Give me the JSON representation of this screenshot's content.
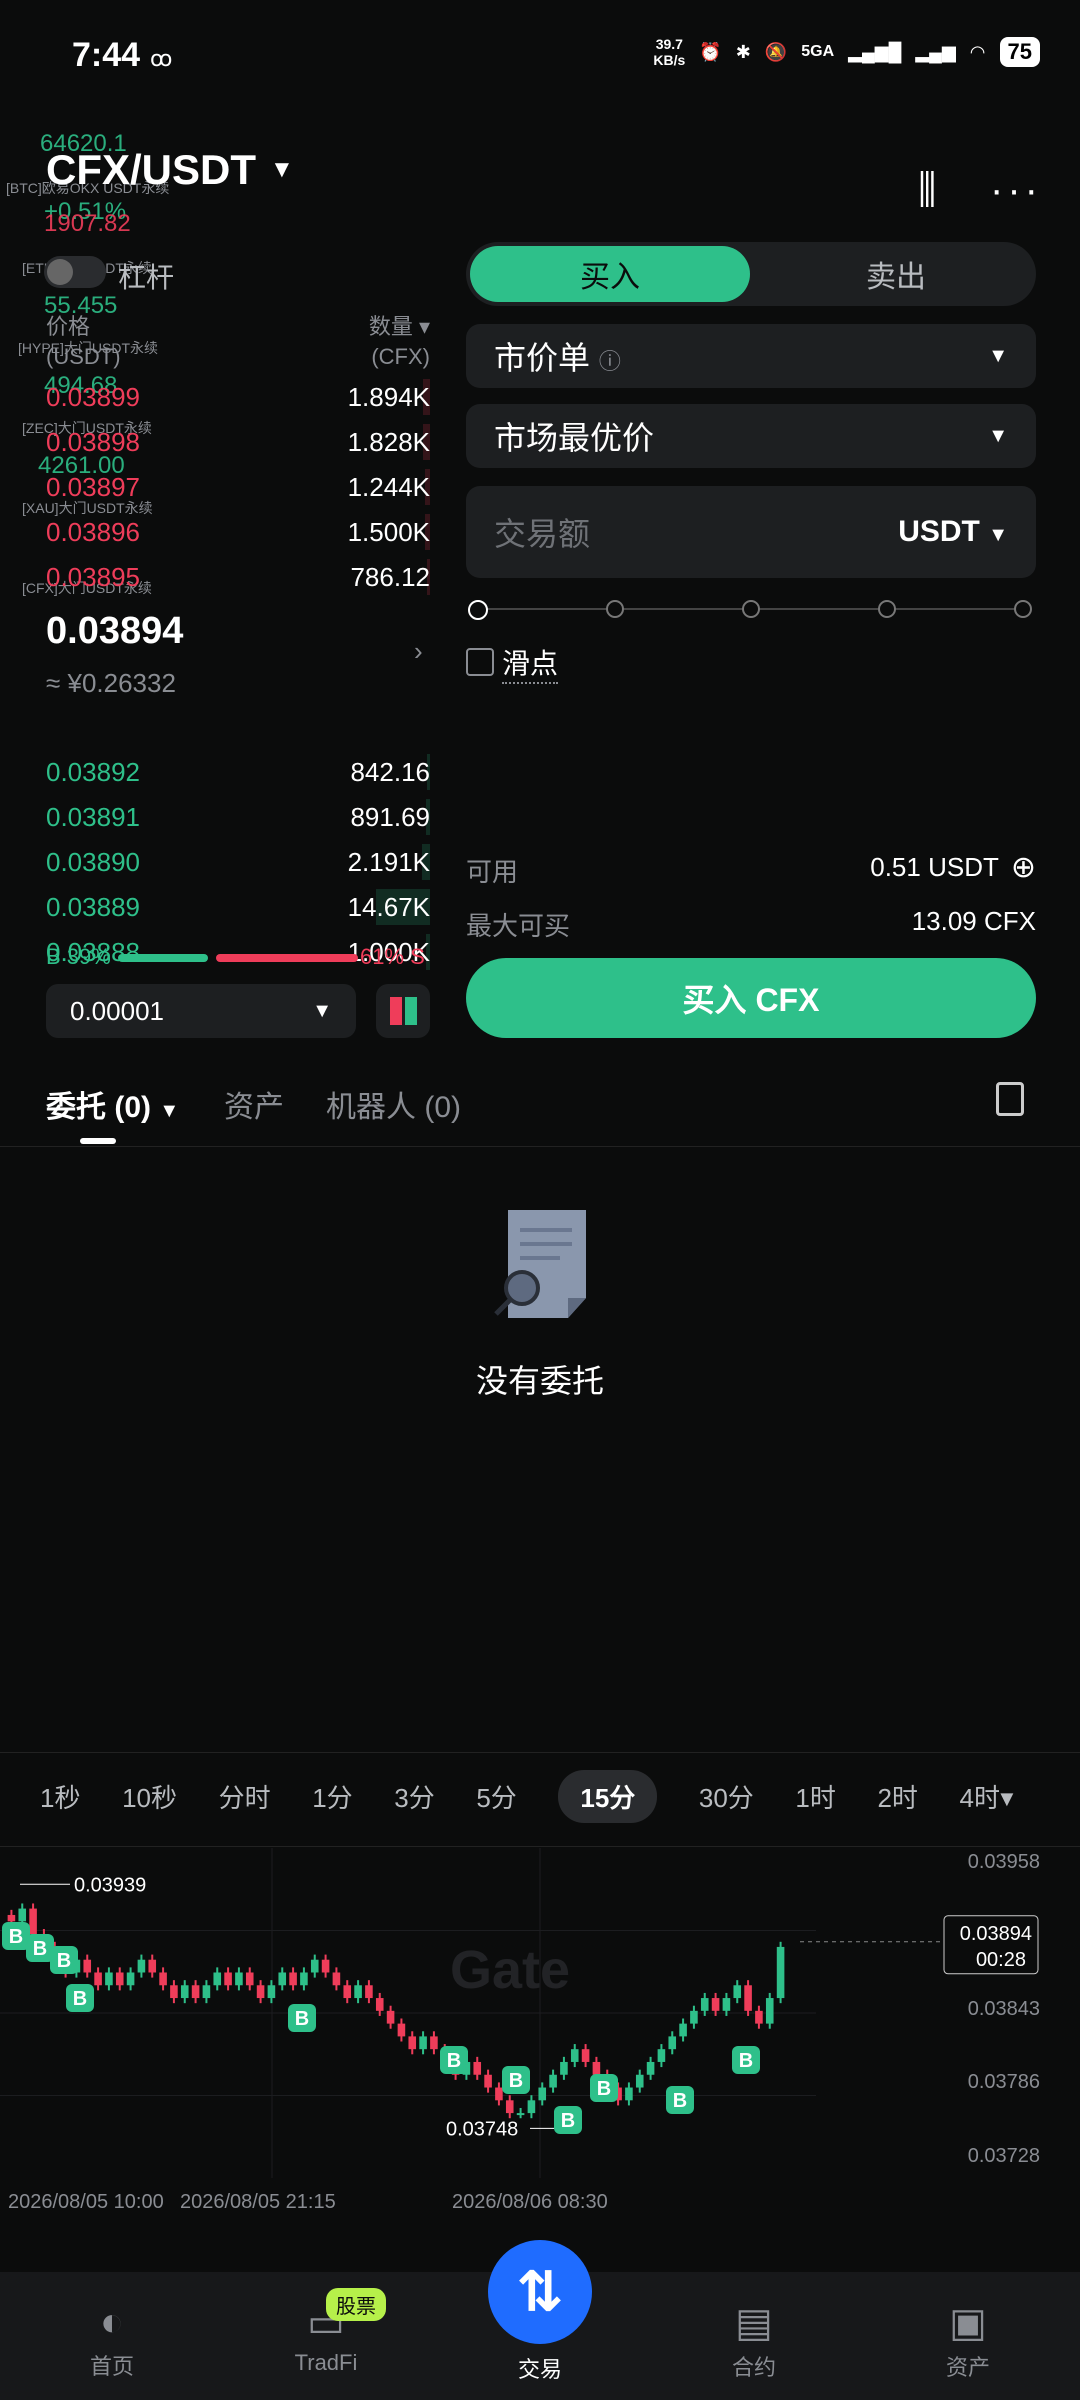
{
  "status": {
    "time": "7:44",
    "net_speed_value": "39.7",
    "net_speed_unit": "KB/s",
    "network": "5GA",
    "battery": "75"
  },
  "header": {
    "pair": "CFX/USDT",
    "leverage_label": "杠杆"
  },
  "tickers": [
    {
      "name": "[BTC]欧易OKX USDT永续",
      "price": "64620.1",
      "change": "+0.51%",
      "extra": "1907.82"
    },
    {
      "name": "[ETH]大门USDT永续",
      "price": "55.455"
    },
    {
      "name": "[HYPE]大门USDT永续",
      "price": "494.68"
    },
    {
      "name": "[ZEC]大门USDT永续",
      "price": "4261.00"
    },
    {
      "name": "[XAU]大门USDT永续",
      "price": ""
    },
    {
      "name": "[CFX]大门USDT永续",
      "price": ""
    }
  ],
  "orderbook": {
    "price_label": "价格",
    "price_unit": "(USDT)",
    "qty_label": "数量",
    "qty_unit": "(CFX)",
    "asks": [
      {
        "price": "0.03899",
        "qty": "1.894K",
        "depth": 0.12
      },
      {
        "price": "0.03898",
        "qty": "1.828K",
        "depth": 0.11
      },
      {
        "price": "0.03897",
        "qty": "1.244K",
        "depth": 0.08
      },
      {
        "price": "0.03896",
        "qty": "1.500K",
        "depth": 0.09
      },
      {
        "price": "0.03895",
        "qty": "786.12",
        "depth": 0.05
      }
    ],
    "last_price": "0.03894",
    "last_price_fiat": "≈ ¥0.26332",
    "bids": [
      {
        "price": "0.03892",
        "qty": "842.16",
        "depth": 0.05
      },
      {
        "price": "0.03891",
        "qty": "891.69",
        "depth": 0.06
      },
      {
        "price": "0.03890",
        "qty": "2.191K",
        "depth": 0.13
      },
      {
        "price": "0.03889",
        "qty": "14.67K",
        "depth": 0.9
      },
      {
        "price": "0.03888",
        "qty": "1.000K",
        "depth": 0.07
      }
    ],
    "buy_ratio": "B 39%",
    "sell_ratio": "61% S",
    "buy_ratio_value": 0.39,
    "precision": "0.00001"
  },
  "form": {
    "buy_tab": "买入",
    "sell_tab": "卖出",
    "order_type": "市价单",
    "price_type": "市场最优价",
    "amount_placeholder": "交易额",
    "amount_unit": "USDT",
    "slippage_label": "滑点",
    "available_label": "可用",
    "available_value": "0.51 USDT",
    "max_buy_label": "最大可买",
    "max_buy_value": "13.09 CFX",
    "buy_button": "买入 CFX"
  },
  "orders_tabs": {
    "orders": "委托 (0)",
    "assets": "资产",
    "bots": "机器人 (0)"
  },
  "empty_state": "没有委托",
  "timeframes": [
    "1秒",
    "10秒",
    "分时",
    "1分",
    "3分",
    "5分",
    "15分",
    "30分",
    "1时",
    "2时",
    "4时"
  ],
  "active_timeframe": "15分",
  "chart_data": {
    "type": "candlestick",
    "y_ticks": [
      "0.03958",
      "0.03843",
      "0.03786",
      "0.03728"
    ],
    "x_ticks": [
      "2026/08/05 10:00",
      "2026/08/05 21:15",
      "2026/08/06 08:30"
    ],
    "high_label": "0.03939",
    "low_label": "0.03748",
    "current_price": "0.03894",
    "countdown": "00:28",
    "closes": [
      0.0391,
      0.0392,
      0.039,
      0.0389,
      0.0388,
      0.0387,
      0.0388,
      0.0387,
      0.0386,
      0.0387,
      0.0386,
      0.0387,
      0.0388,
      0.0387,
      0.0386,
      0.0385,
      0.0386,
      0.0385,
      0.0386,
      0.0387,
      0.0386,
      0.0387,
      0.0386,
      0.0385,
      0.0386,
      0.0387,
      0.0386,
      0.0387,
      0.0388,
      0.0387,
      0.0386,
      0.0385,
      0.0386,
      0.0385,
      0.0384,
      0.0383,
      0.0382,
      0.0381,
      0.0382,
      0.0381,
      0.038,
      0.0379,
      0.038,
      0.0379,
      0.0378,
      0.0377,
      0.0376,
      0.0376,
      0.0377,
      0.0378,
      0.0379,
      0.038,
      0.0381,
      0.038,
      0.0379,
      0.0378,
      0.0377,
      0.0378,
      0.0379,
      0.038,
      0.0381,
      0.0382,
      0.0383,
      0.0384,
      0.0385,
      0.0384,
      0.0385,
      0.0386,
      0.0384,
      0.0383,
      0.0385,
      0.0389
    ]
  },
  "watermark": "Gate",
  "nav": [
    {
      "label": "首页",
      "icon": "home-icon"
    },
    {
      "label": "TradFi",
      "icon": "tradfi-icon",
      "badge": "股票"
    },
    {
      "label": "交易",
      "icon": "trade-icon"
    },
    {
      "label": "合约",
      "icon": "futures-icon"
    },
    {
      "label": "资产",
      "icon": "wallet-icon"
    }
  ]
}
